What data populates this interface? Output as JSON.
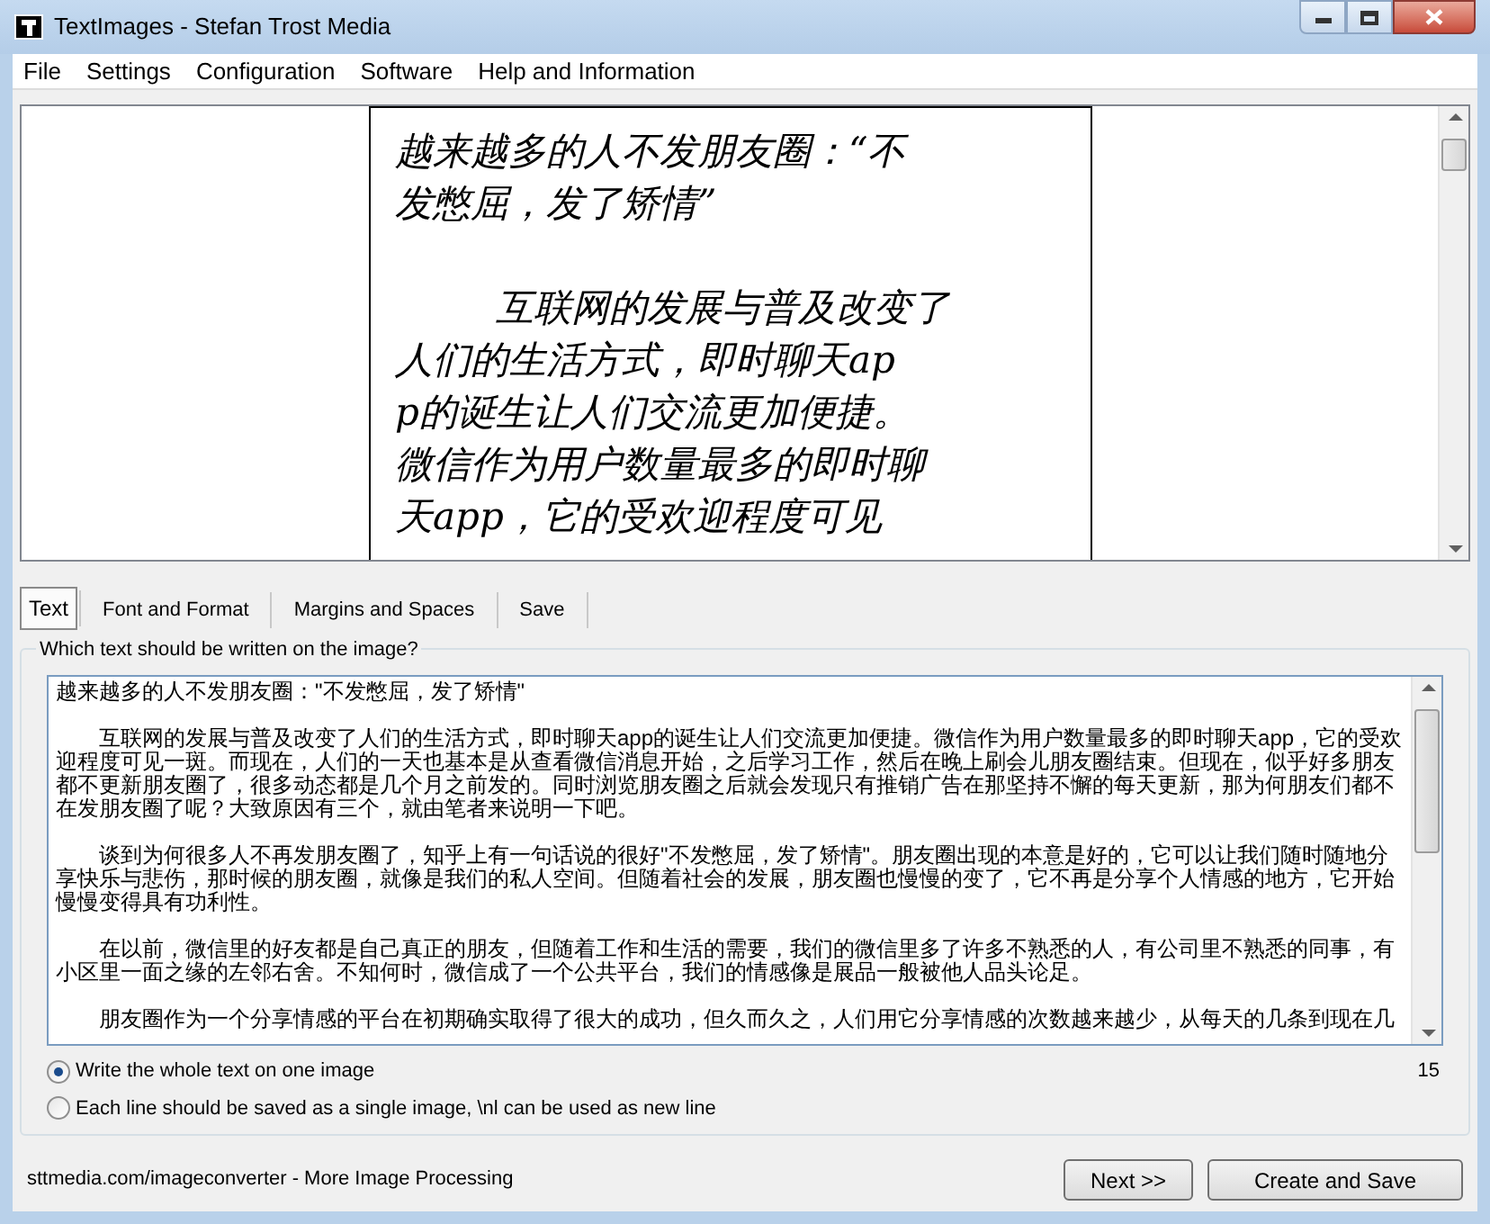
{
  "window": {
    "title": "TextImages - Stefan Trost Media"
  },
  "menu": [
    "File",
    "Settings",
    "Configuration",
    "Software",
    "Help and Information"
  ],
  "preview": {
    "lines": [
      {
        "text": "越来越多的人不发朋友圈：“不",
        "indent": false
      },
      {
        "text": "发憋屈，发了矫情”",
        "indent": false
      },
      {
        "text": "互联网的发展与普及改变了",
        "indent": true
      },
      {
        "text": "人们的生活方式，即时聊天ap",
        "indent": false
      },
      {
        "text": "p的诞生让人们交流更加便捷。",
        "indent": false
      },
      {
        "text": "微信作为用户数量最多的即时聊",
        "indent": false
      },
      {
        "text": "天app，它的受欢迎程度可见",
        "indent": false
      }
    ]
  },
  "tabs": [
    {
      "label": "Text",
      "selected": true
    },
    {
      "label": "Font and Format",
      "selected": false
    },
    {
      "label": "Margins and Spaces",
      "selected": false
    },
    {
      "label": "Save",
      "selected": false
    }
  ],
  "group": {
    "title": "Which text should be written on the image?",
    "paragraphs": [
      {
        "text": "越来越多的人不发朋友圈：\"不发憋屈，发了矫情\"",
        "indent": false
      },
      {
        "text": "互联网的发展与普及改变了人们的生活方式，即时聊天app的诞生让人们交流更加便捷。微信作为用户数量最多的即时聊天app，它的受欢迎程度可见一斑。而现在，人们的一天也基本是从查看微信消息开始，之后学习工作，然后在晚上刷会儿朋友圈结束。但现在，似乎好多朋友都不更新朋友圈了，很多动态都是几个月之前发的。同时浏览朋友圈之后就会发现只有推销广告在那坚持不懈的每天更新，那为何朋友们都不在发朋友圈了呢？大致原因有三个，就由笔者来说明一下吧。",
        "indent": true
      },
      {
        "text": "谈到为何很多人不再发朋友圈了，知乎上有一句话说的很好\"不发憋屈，发了矫情\"。朋友圈出现的本意是好的，它可以让我们随时随地分享快乐与悲伤，那时候的朋友圈，就像是我们的私人空间。但随着社会的发展，朋友圈也慢慢的变了，它不再是分享个人情感的地方，它开始慢慢变得具有功利性。",
        "indent": true
      },
      {
        "text": "在以前，微信里的好友都是自己真正的朋友，但随着工作和生活的需要，我们的微信里多了许多不熟悉的人，有公司里不熟悉的同事，有小区里一面之缘的左邻右舍。不知何时，微信成了一个公共平台，我们的情感像是展品一般被他人品头论足。",
        "indent": true
      },
      {
        "text": "朋友圈作为一个分享情感的平台在初期确实取得了很大的成功，但久而久之，人们用它分享情感的次数越来越少，从每天的几条到现在几",
        "indent": true
      }
    ],
    "options": [
      {
        "label": "Write the whole text on one image",
        "selected": true
      },
      {
        "label": "Each line should be saved as a single image, \\nl can be used as new line",
        "selected": false
      }
    ],
    "count": "15"
  },
  "status_bar": {
    "text": "sttmedia.com/imageconverter - More Image Processing"
  },
  "buttons": [
    "Next >>",
    "Create and Save"
  ]
}
